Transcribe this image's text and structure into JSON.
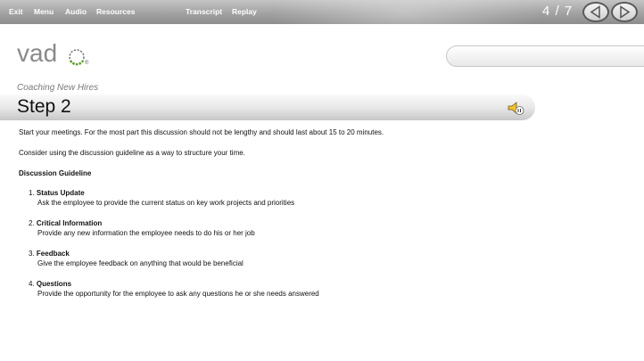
{
  "toolbar": {
    "links": [
      "Exit",
      "Menu",
      "Audio",
      "Resources",
      "Transcript",
      "Replay"
    ],
    "page_counter": "4 / 7"
  },
  "logo": {
    "text": "vad",
    "mark": "o",
    "registered": "®"
  },
  "course_title": "Coaching New Hires",
  "step_title": "Step 2",
  "content": {
    "intro": "Start your meetings. For the most part this discussion should not be lengthy and should last about 15 to 20 minutes.",
    "hint": "Consider using the discussion guideline as a way to structure your time.",
    "guideline_heading": "Discussion Guideline",
    "items": [
      {
        "number": "1.",
        "title": "Status Update",
        "description": "Ask the employee to provide the current status on key work projects and priorities"
      },
      {
        "number": "2.",
        "title": "Critical Information",
        "description": "Provide any new information the employee needs to do his or her job"
      },
      {
        "number": "3.",
        "title": "Feedback",
        "description": "Give the employee feedback on anything that would be beneficial"
      },
      {
        "number": "4.",
        "title": "Questions",
        "description": "Provide the opportunity for the employee to ask any questions he or she needs answered"
      }
    ]
  },
  "icons": [
    "prev-arrow-icon",
    "next-arrow-icon",
    "audio-speaker-icon"
  ],
  "colors": {
    "toolbar": "#a2a2a2",
    "logo_green": "#5aa02c"
  }
}
